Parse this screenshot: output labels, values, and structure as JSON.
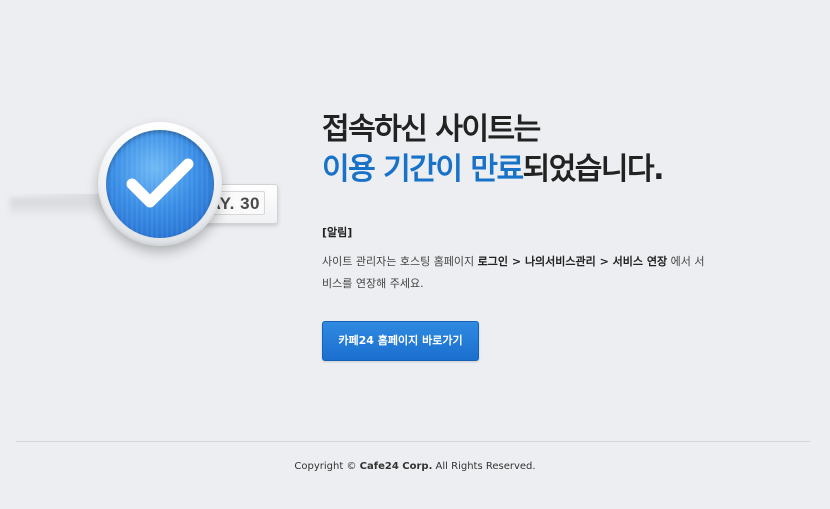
{
  "illustration": {
    "day_tag": "AY. 30",
    "icon": "check-badge-icon",
    "badge_color": "#2f84e0"
  },
  "headline": {
    "line1": "접속하신 사이트는",
    "line2_highlight": "이용 기간이 만료",
    "line2_rest": "되었습니다.",
    "highlight_color": "#1772c8"
  },
  "notice": {
    "title": "[알림]",
    "text_part1": "사이트 관리자는 호스팅 홈페이지 ",
    "path_login": "로그인",
    "separator1": " > ",
    "path_my_services": "나의서비스관리",
    "separator2": " > ",
    "path_extend": "서비스 연장",
    "text_part2": " 에서 서비스를 연장해 주세요."
  },
  "cta": {
    "label": "카페24 홈페이지 바로가기",
    "color": "#1f74d4"
  },
  "footer": {
    "prefix": "Copyright © ",
    "company": "Cafe24 Corp.",
    "suffix": " All Rights Reserved."
  }
}
